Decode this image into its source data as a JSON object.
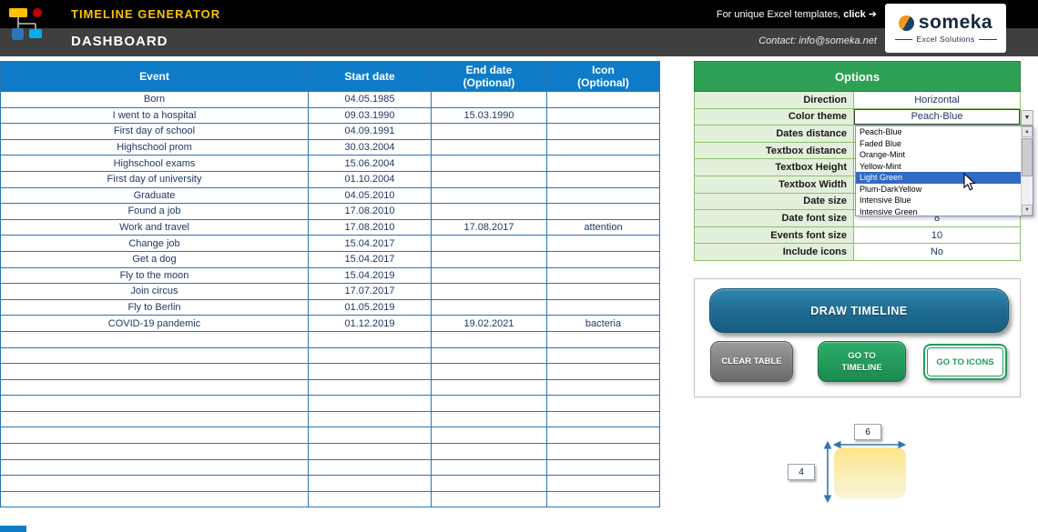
{
  "colors": {
    "header_bg": "#000000",
    "header_bar": "#3F3F3F",
    "accent_yellow": "#FFC000",
    "table_header_blue": "#0E7CC9",
    "table_border_blue": "#2E74B5",
    "options_header_green": "#2EA154",
    "option_label_bg": "#E2EFDA",
    "option_border_green": "#8DBF6E",
    "dropdown_highlight": "#316AC5",
    "draw_button_blue": "#1E6A8E",
    "action_green": "#1F9E5C",
    "gray_button": "#7F7F7F",
    "measure_arrow_blue": "#2E74B5",
    "preview_yellow": "#FFE699"
  },
  "header": {
    "title": "TIMELINE GENERATOR",
    "subtitle": "DASHBOARD",
    "promo_prefix": "For unique Excel templates, ",
    "promo_click": "click",
    "promo_arrow": "➔",
    "contact": "Contact: info@someka.net",
    "logo_name": "someka",
    "logo_tagline": "Excel Solutions"
  },
  "table": {
    "columns": [
      "Event",
      "Start date",
      "End date\n(Optional)",
      "Icon\n(Optional)"
    ],
    "rows": [
      [
        "Born",
        "04.05.1985",
        "",
        ""
      ],
      [
        "I went to a hospital",
        "09.03.1990",
        "15.03.1990",
        ""
      ],
      [
        "First day of school",
        "04.09.1991",
        "",
        ""
      ],
      [
        "Highschool prom",
        "30.03.2004",
        "",
        ""
      ],
      [
        "Highschool exams",
        "15.06.2004",
        "",
        ""
      ],
      [
        "First day of university",
        "01.10.2004",
        "",
        ""
      ],
      [
        "Graduate",
        "04.05.2010",
        "",
        ""
      ],
      [
        "Found a job",
        "17.08.2010",
        "",
        ""
      ],
      [
        "Work and travel",
        "17.08.2010",
        "17.08.2017",
        "attention"
      ],
      [
        "Change job",
        "15.04.2017",
        "",
        ""
      ],
      [
        "Get a dog",
        "15.04.2017",
        "",
        ""
      ],
      [
        "Fly to the moon",
        "15.04.2019",
        "",
        ""
      ],
      [
        "Join circus",
        "17.07.2017",
        "",
        ""
      ],
      [
        "Fly to Berlin",
        "01.05.2019",
        "",
        ""
      ],
      [
        "COVID-19 pandemic",
        "01.12.2019",
        "19.02.2021",
        "bacteria"
      ]
    ],
    "empty_rows": 11
  },
  "options": {
    "title": "Options",
    "rows": [
      {
        "label": "Direction",
        "value": "Horizontal"
      },
      {
        "label": "Color theme",
        "value": "Peach-Blue",
        "combo": true
      },
      {
        "label": "Dates distance",
        "value": ""
      },
      {
        "label": "Textbox distance",
        "value": ""
      },
      {
        "label": "Textbox Height",
        "value": ""
      },
      {
        "label": "Textbox Width",
        "value": ""
      },
      {
        "label": "Date size",
        "value": ""
      },
      {
        "label": "Date font size",
        "value": "8"
      },
      {
        "label": "Events font size",
        "value": "10"
      },
      {
        "label": "Include icons",
        "value": "No"
      }
    ],
    "dropdown_items": [
      "Peach-Blue",
      "Faded Blue",
      "Orange-Mint",
      "Yellow-Mint",
      "Light Green",
      "Plum-DarkYellow",
      "Intensive Blue",
      "Intensive Green"
    ],
    "dropdown_selected_index": 4,
    "combo_arrow": "▼",
    "scroll_up": "▲",
    "scroll_down": "▼"
  },
  "buttons": {
    "draw": "DRAW TIMELINE",
    "clear": "CLEAR TABLE",
    "go_timeline": "GO TO TIMELINE",
    "go_icons": "GO TO ICONS"
  },
  "size_preview": {
    "width_value": "6",
    "height_value": "4"
  }
}
